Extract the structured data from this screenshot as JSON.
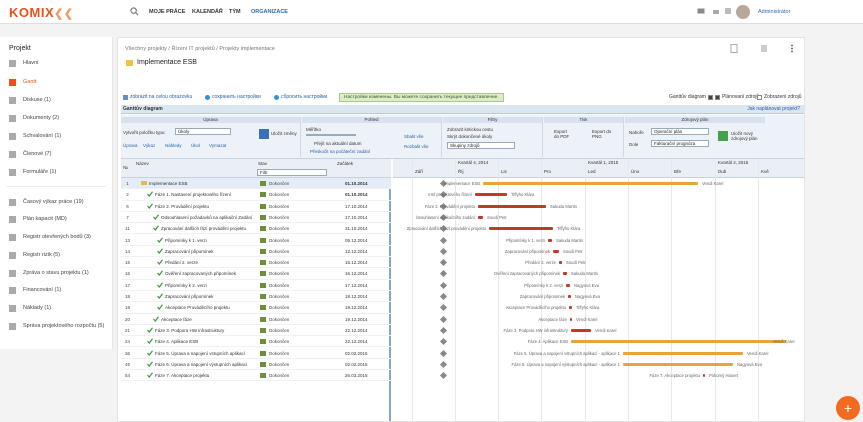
{
  "app": {
    "logo": "KOMIX",
    "nav": [
      "MOJE PRÁCE",
      "KALENDÁŘ",
      "TÝM",
      "ORGANIZACE"
    ],
    "active_nav": "ORGANIZACE",
    "user": "Administrátor"
  },
  "sidebar": {
    "title": "Projekt",
    "items": [
      {
        "label": "Hlavní"
      },
      {
        "label": "Gantt"
      },
      {
        "label": "Diskuse (1)"
      },
      {
        "label": "Dokumenty (2)"
      },
      {
        "label": "Schvalování (1)"
      },
      {
        "label": "Členové (7)"
      },
      {
        "label": "Formuláře (1)"
      },
      {
        "label": "Časový výkaz práce (19)"
      },
      {
        "label": "Plán kapacit (MD)"
      },
      {
        "label": "Registr otevřených bodů (3)"
      },
      {
        "label": "Registr rizik (5)"
      },
      {
        "label": "Zpráva o stavu projektu (1)"
      },
      {
        "label": "Financování (1)"
      },
      {
        "label": "Náklady (1)"
      },
      {
        "label": "Správa projektového rozpočtu (5)"
      }
    ]
  },
  "breadcrumb": "Všechny projekty / Řízení IT projektů / Projekty implementace",
  "page_title": "Implementace ESB",
  "toolbar": {
    "show_on_page": "zobrazit na celou obrazovku",
    "save_settings": "сохранить настройки",
    "reset_settings": "сбросить настройки",
    "message": "Настройки изменены. Вы можете сохранить текущее представление.",
    "gantt_chk": "Ganttův diagram",
    "planned_chk": "Plánovaní zdrojů",
    "show_chk": "Zobrazení zdrojů"
  },
  "gantt_title": "Ganttův diagram",
  "planned_link": "Jak naplánovat projekt?",
  "ribbon": {
    "groups": [
      "Úprava",
      "Pohled",
      "Filtry",
      "Tisk",
      "Zdrojový plán"
    ],
    "task_type_label": "Vytvořit položku typu:",
    "task_type": "Úkoly",
    "actions": [
      "Úprava",
      "Výkaz",
      "Náhledy",
      "Úkol",
      "Vymazat"
    ],
    "save_label": "Uložit změny",
    "width_label": "Měřítko",
    "view_opts": [
      "Přejít na aktuální datum",
      "Přeskočit na počáteční zadání"
    ],
    "show_all": "Sbalit vše",
    "expand_all": "Rozbalit vše",
    "filters": [
      "Zobrazit kritickou cestu",
      "Skrýt dokončené úkoly"
    ],
    "filter_value": "Skupiny zdrojů",
    "print": [
      "Export do PDF",
      "Export do PNG"
    ],
    "res_labels": [
      "Nahoře",
      "Dole"
    ],
    "res_values": [
      "Operační plán",
      "Fakturační prognóza"
    ],
    "res_btn": "Uložit nový zdrojový plán"
  },
  "grid": {
    "headers": [
      "Název",
      "Stav",
      "Začátek"
    ],
    "filter": "Filtr",
    "rows": [
      {
        "no": "1",
        "name": "Implementace ESB",
        "status": "Dokončen",
        "start": "01.10.2014"
      },
      {
        "no": "2",
        "name": "Fáze 1. Nastavení projektového řízení",
        "status": "Dokončen",
        "start": "01.10.2014"
      },
      {
        "no": "6",
        "name": "Fáze 2. Provádění projektu",
        "status": "Dokončen",
        "start": "17.10.2014"
      },
      {
        "no": "7",
        "name": "Odsouhlasení požadavků na aplikační Zadání",
        "status": "Dokončen",
        "start": "17.10.2014"
      },
      {
        "no": "11",
        "name": "Zpracování dalších fází provádění projektu",
        "status": "Dokončen",
        "start": "31.10.2014"
      },
      {
        "no": "13",
        "name": "Připomínky k 1. verzi",
        "status": "Dokončen",
        "start": "05.12.2014"
      },
      {
        "no": "14",
        "name": "Zapracování připomínek",
        "status": "Dokončen",
        "start": "12.12.2014"
      },
      {
        "no": "15",
        "name": "Předání 2. verze",
        "status": "Dokončen",
        "start": "15.12.2014"
      },
      {
        "no": "16",
        "name": "Ověření zapracovaných připomínek",
        "status": "Dokončen",
        "start": "16.12.2014"
      },
      {
        "no": "17",
        "name": "Připomínky k 2. verzi",
        "status": "Dokončen",
        "start": "17.12.2014"
      },
      {
        "no": "18",
        "name": "Zapracování připomínek",
        "status": "Dokončen",
        "start": "18.12.2014"
      },
      {
        "no": "19",
        "name": "Akceptace Prováděcího projektu",
        "status": "Dokončen",
        "start": "19.12.2014"
      },
      {
        "no": "20",
        "name": "Akceptace fáze",
        "status": "Dokončen",
        "start": "19.12.2014"
      },
      {
        "no": "21",
        "name": "Fáze 3. Podpora HW infrastruktury",
        "status": "Dokončen",
        "start": "22.12.2014"
      },
      {
        "no": "24",
        "name": "Fáze 4. Aplikace ESB",
        "status": "Dokončen",
        "start": "22.12.2014"
      },
      {
        "no": "36",
        "name": "Fáze 5. Úprava a napojení vstupních aplikací",
        "status": "Dokončen",
        "start": "02.02.2015"
      },
      {
        "no": "45",
        "name": "Fáze 6. Úprava a napojení výstupních aplikací",
        "status": "Dokončen",
        "start": "02.02.2015"
      },
      {
        "no": "54",
        "name": "Fáze 7. Akceptace projektu",
        "status": "Dokončen",
        "start": "26.03.2015"
      }
    ]
  },
  "chart": {
    "quarters": [
      "Kvartál 4, 2014",
      "Kvartál 1, 2015",
      "Kvartál 2, 2015"
    ],
    "months": [
      "Září",
      "Říj",
      "Lis",
      "Pro",
      "Led",
      "Úno",
      "Bře",
      "Dub",
      "Kvě"
    ],
    "labels": [
      "Implementace ESB",
      "Irml projektového řízení",
      "Fáze 2. Provádění projektu",
      "bsouhlasení aplikačního zadání",
      "Zpracování dalších fází provádění projektu",
      "Připomínky k 1. verzi",
      "Zapracování připomínek",
      "Předání 2. verze",
      "Ověření zapracovaných připomínek",
      "Připomínky k 2. verzi",
      "Zapracování připomínek",
      "Akceptace Prováděcího projektu",
      "Akceptace fáze",
      "Fáze 3. Podpora HW infrastruktury",
      "Fáze 4. Aplikace ESB",
      "Fáze 5. Úprava a napojení vstupních aplikací - aplikace 1",
      "Fáze 6. Úprava a napojení výstupních aplikací - aplikace 1",
      "Fáze 7. Akceptace projektu"
    ],
    "owners": [
      "Vendi Karel",
      "Tiffyho Klára",
      "Sakuda Martin",
      "Soudí Petr",
      "Tiffyho Klára",
      "Sakuda Martin",
      "Soudí Petr",
      "Soudí Petr",
      "Sakuda Martin",
      "Nagyová Eva",
      "Nagyová Eva",
      "Tiffyho Klára",
      "Vendi Karel",
      "Vendi Karel",
      "Vendi Karel",
      "Vendi Karel",
      "Nagyová Eva",
      "Pokorný Hauert"
    ]
  },
  "fab": "+"
}
